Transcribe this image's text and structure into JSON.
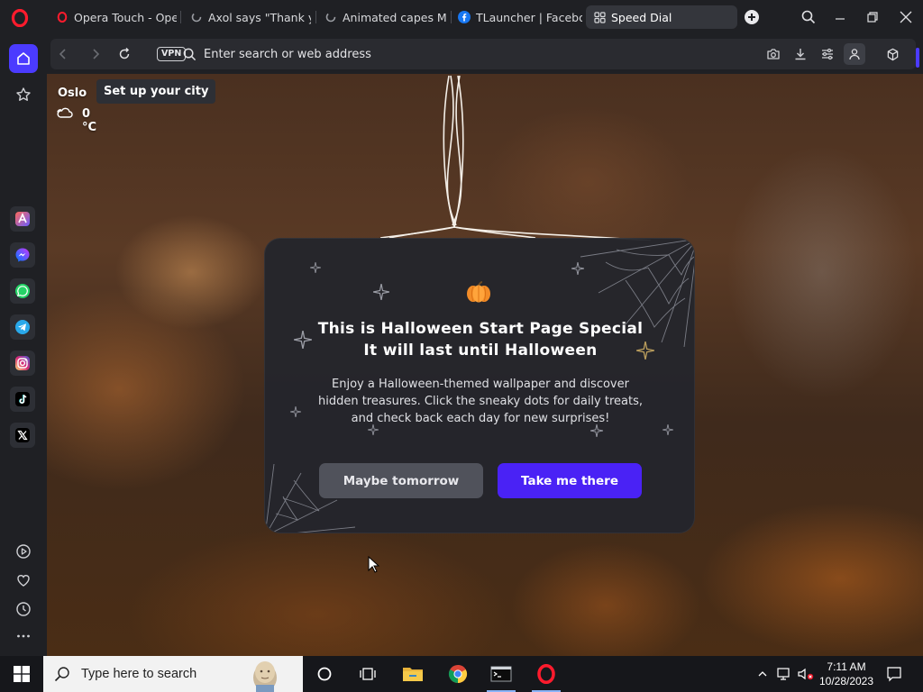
{
  "browser": {
    "tabs": [
      {
        "label": "Opera Touch - Opera",
        "icon": "opera-icon",
        "active": false
      },
      {
        "label": "Axol says \"Thank you",
        "icon": "loading-icon",
        "active": false
      },
      {
        "label": "Animated capes Mine",
        "icon": "loading-icon",
        "active": false
      },
      {
        "label": "TLauncher | Facebook",
        "icon": "facebook-icon",
        "active": false
      },
      {
        "label": "Speed Dial",
        "icon": "speed-dial-icon",
        "active": true
      }
    ],
    "address_placeholder": "Enter search or web address",
    "vpn_label": "VPN",
    "accent_color": "#4b3bff"
  },
  "sidebar": {
    "items": [
      "home-icon",
      "bookmarks-star-icon"
    ],
    "apps": [
      "aria-icon",
      "messenger-icon",
      "whatsapp-icon",
      "telegram-icon",
      "instagram-icon",
      "tiktok-icon",
      "x-twitter-icon"
    ],
    "bottom": [
      "player-icon",
      "heart-icon",
      "history-clock-icon",
      "more-icon"
    ]
  },
  "weather": {
    "city": "Oslo",
    "setup_tooltip": "Set up your city",
    "temperature": "0 °C",
    "icon": "cloudy-icon"
  },
  "halloween_card": {
    "title_line1": "This is Halloween Start Page Special",
    "title_line2": "It will last until Halloween",
    "body": "Enjoy a Halloween-themed wallpaper and discover hidden treasures. Click the sneaky dots for daily treats, and check back each day for new surprises!",
    "secondary_button": "Maybe tomorrow",
    "primary_button": "Take me there",
    "primary_color": "#4a22f5"
  },
  "taskbar": {
    "search_placeholder": "Type here to search",
    "apps": [
      "cortana-icon",
      "task-view-icon",
      "file-explorer-icon",
      "chrome-icon",
      "terminal-icon",
      "opera-icon"
    ],
    "clock_time": "7:11 AM",
    "clock_date": "10/28/2023"
  }
}
